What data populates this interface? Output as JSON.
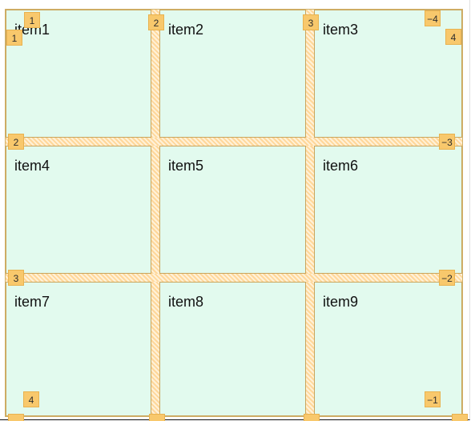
{
  "grid": {
    "items": [
      {
        "label": "item1"
      },
      {
        "label": "item2"
      },
      {
        "label": "item3"
      },
      {
        "label": "item4"
      },
      {
        "label": "item5"
      },
      {
        "label": "item6"
      },
      {
        "label": "item7"
      },
      {
        "label": "item8"
      },
      {
        "label": "item9"
      }
    ]
  },
  "overlay": {
    "column_line_numbers_top": [
      "1",
      "2",
      "3",
      "−4"
    ],
    "column_line_numbers_bottom": [
      "4",
      "−1"
    ],
    "row_line_numbers_left": [
      "1",
      "2",
      "3"
    ],
    "row_line_numbers_right": [
      "4",
      "−3",
      "−2"
    ],
    "badge_color": "#f8c86c",
    "cell_color": "#e2faee",
    "gap_color": "#ffe0a8"
  }
}
